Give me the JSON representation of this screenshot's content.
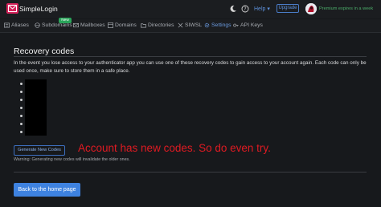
{
  "header": {
    "brand": "SimpleLogin",
    "help_label": "Help",
    "upgrade_label": "Upgrade",
    "premium_text": "Premium expires in a week",
    "colors": {
      "brand": "#d6245c",
      "link": "#5d8fd8",
      "premium": "#4cae6a"
    }
  },
  "nav": {
    "items": [
      {
        "label": "Aliases",
        "icon": "aliases-icon"
      },
      {
        "label": "Subdomains",
        "icon": "subdomains-icon"
      },
      {
        "label": "Mailboxes",
        "icon": "mailbox-icon"
      },
      {
        "label": "Domains",
        "icon": "domains-icon"
      },
      {
        "label": "Directories",
        "icon": "folder-icon"
      },
      {
        "label": "SIWSL",
        "icon": "siwsl-icon"
      },
      {
        "label": "Settings",
        "icon": "gear-icon"
      },
      {
        "label": "API Keys",
        "icon": "key-icon"
      }
    ],
    "active": "Settings",
    "new_badge": "New"
  },
  "main": {
    "title": "Recovery codes",
    "description": "In the event you lose access to your authenticator app you can use one of these recovery codes to gain access to your account again. Each code can only be used once, make sure to store them in a safe place.",
    "generate_label": "Generate New Codes",
    "warning": "Warning: Generating new codes will invalidate the older ones.",
    "home_label": "Back to the home page"
  },
  "annotation": "Account has new codes. So do even try."
}
